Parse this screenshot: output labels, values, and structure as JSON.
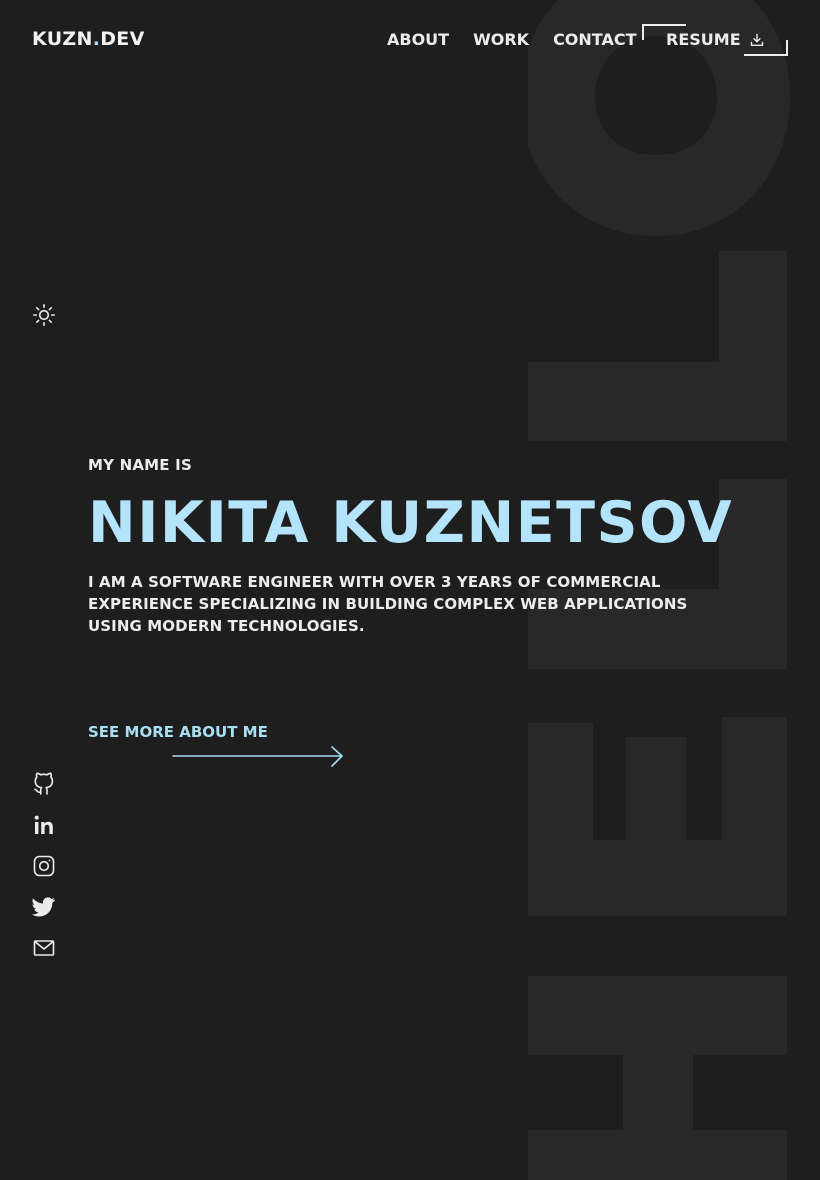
{
  "logo": {
    "main": "KUZN",
    "dot": ".",
    "tld": "DEV"
  },
  "nav": {
    "items": [
      "ABOUT",
      "WORK",
      "CONTACT"
    ],
    "resume_label": "RESUME"
  },
  "background_word": "HELLO",
  "hero": {
    "intro": "MY NAME IS",
    "name": "NIKITA KUZNETSOV",
    "tagline": "I AM A SOFTWARE ENGINEER WITH OVER 3 YEARS OF COMMERCIAL EXPERIENCE SPECIALIZING IN BUILDING COMPLEX WEB APPLICATIONS USING MODERN TECHNOLOGIES.",
    "cta": "SEE MORE ABOUT ME"
  },
  "icons": {
    "theme": "sun-icon",
    "download": "download-icon",
    "arrow": "arrow-right-icon",
    "socials": [
      "github-icon",
      "linkedin-icon",
      "instagram-icon",
      "twitter-icon",
      "mail-icon"
    ]
  },
  "colors": {
    "background": "#1e1e1e",
    "accent": "#b4e4fb",
    "text": "#ececec",
    "background_word": "#282828"
  }
}
